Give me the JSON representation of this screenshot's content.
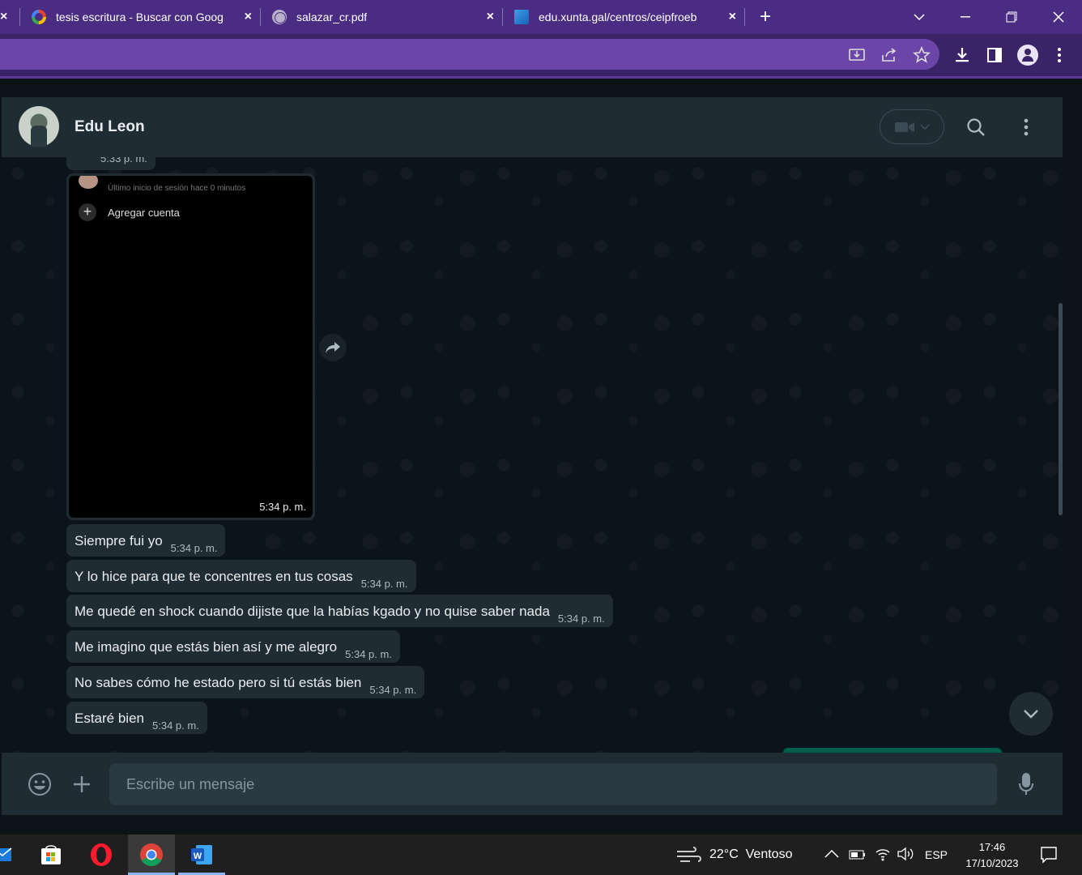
{
  "browser": {
    "tabs": [
      {
        "title": "tesis escritura - Buscar con Goog",
        "icon": "google-icon"
      },
      {
        "title": "salazar_cr.pdf",
        "icon": "globe-icon"
      },
      {
        "title": "edu.xunta.gal/centros/ceipfroeb",
        "icon": "xunta-icon"
      }
    ],
    "new_tab_label": "+",
    "close_glyph": "×"
  },
  "chat": {
    "contact_name": "Edu Leon",
    "previous_time": "5:33 p. m.",
    "image_message": {
      "partial_text": "Último inicio de sesión hace 0 minutos",
      "add_account_label": "Agregar cuenta",
      "time": "5:34 p. m."
    },
    "messages": [
      {
        "text": "Siempre fui yo",
        "time": "5:34 p. m."
      },
      {
        "text": "Y lo hice para que te concentres en tus cosas",
        "time": "5:34 p. m."
      },
      {
        "text": "Me quedé en shock cuando dijiste que la habías kgado y no quise saber nada",
        "time": "5:34 p. m."
      },
      {
        "text": "Me imagino que estás bien así y me alegro",
        "time": "5:34 p. m."
      },
      {
        "text": "No sabes cómo he estado pero si tú estás bien",
        "time": "5:34 p. m."
      },
      {
        "text": "Estaré bien",
        "time": "5:34 p. m."
      }
    ],
    "input_placeholder": "Escribe un mensaje"
  },
  "taskbar": {
    "weather": "22°C  Ventoso",
    "language": "ESP",
    "time": "17:46",
    "date": "17/10/2023"
  },
  "colors": {
    "browser_accent": "#4a2c82",
    "wa_panel": "#202c33",
    "wa_background": "#0b141a",
    "outgoing_green": "#005c4b"
  }
}
